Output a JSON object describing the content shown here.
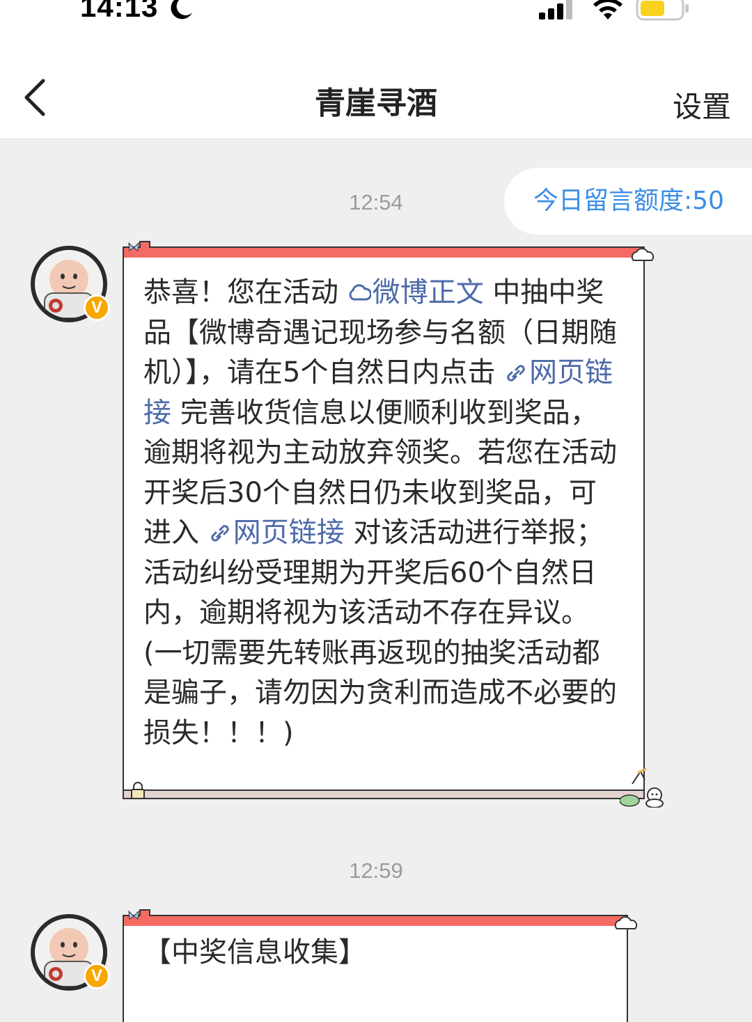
{
  "status_bar": {
    "time": "14:13",
    "icons": [
      "moon-icon",
      "signal-icon",
      "wifi-icon",
      "battery-icon"
    ]
  },
  "nav": {
    "title": "青崖寻酒",
    "settings_label": "设置",
    "back_icon": "chevron-left-icon"
  },
  "chat": {
    "quota_label": "今日留言额度:50",
    "messages": [
      {
        "time": "12:54",
        "verified_badge": "V",
        "segments": [
          {
            "text": "恭喜！您在活动 ",
            "type": "text"
          },
          {
            "text": "微博正文",
            "type": "link",
            "icon": "weibo-icon"
          },
          {
            "text": " 中抽中奖品【微博奇遇记现场参与名额（日期随机）】，请在5个自然日内点击 ",
            "type": "text"
          },
          {
            "text": "网页链接",
            "type": "link",
            "icon": "link-icon"
          },
          {
            "text": " 完善收货信息以便顺利收到奖品，逾期将视为主动放弃领奖。若您在活动开奖后30个自然日仍未收到奖品，可进入 ",
            "type": "text"
          },
          {
            "text": "网页链接",
            "type": "link",
            "icon": "link-icon"
          },
          {
            "text": " 对该活动进行举报；活动纠纷受理期为开奖后60个自然日内，逾期将视为该活动不存在异议。(一切需要先转账再返现的抽奖活动都是骗子，请勿因为贪利而造成不必要的损失！！！)",
            "type": "text"
          }
        ]
      },
      {
        "time": "12:59",
        "verified_badge": "V",
        "text": "【中奖信息收集】"
      }
    ]
  },
  "colors": {
    "link": "#4d6aa8",
    "quota": "#3a8ee6",
    "bubble_header": "#f36b62",
    "badge": "#f7a700"
  }
}
